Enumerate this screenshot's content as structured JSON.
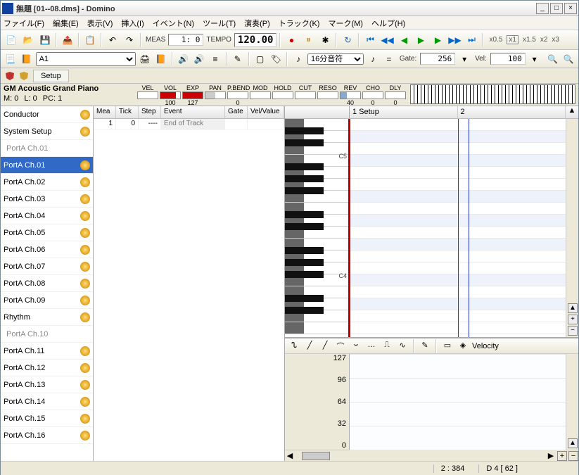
{
  "window": {
    "title": "無題 [01--08.dms] - Domino"
  },
  "menu": {
    "file": "ファイル(F)",
    "edit": "編集(E)",
    "view": "表示(V)",
    "insert": "挿入(I)",
    "event": "イベント(N)",
    "tool": "ツール(T)",
    "play": "演奏(P)",
    "track": "トラック(K)",
    "mark": "マーク(M)",
    "help": "ヘルプ(H)"
  },
  "transport": {
    "meas_label": "MEAS",
    "meas": "1:    0",
    "tempo_label": "TEMPO",
    "tempo": "120.00"
  },
  "zoom": {
    "z05": "x0.5",
    "z1": "x1",
    "z15": "x1.5",
    "z2": "x2",
    "z3": "x3"
  },
  "patch": {
    "selected": "A1",
    "noteval": "16分音符",
    "gate_label": "Gate:",
    "gate": "256",
    "vel_label": "Vel:",
    "vel": "100"
  },
  "setup": {
    "label": "Setup"
  },
  "instrument": {
    "name": "GM Acoustic Grand Piano",
    "m": "M:    0",
    "l": "L:    0",
    "pc": "PC:    1"
  },
  "cc": [
    {
      "name": "VEL",
      "val": ""
    },
    {
      "name": "VOL",
      "val": "100",
      "color": "#cc0000",
      "pct": 79
    },
    {
      "name": "EXP",
      "val": "127",
      "color": "#cc0000",
      "pct": 100
    },
    {
      "name": "PAN",
      "val": "",
      "color": "#cccccc",
      "pct": 50
    },
    {
      "name": "P.BEND",
      "val": "0"
    },
    {
      "name": "MOD",
      "val": ""
    },
    {
      "name": "HOLD",
      "val": ""
    },
    {
      "name": "CUT",
      "val": ""
    },
    {
      "name": "RESO",
      "val": ""
    },
    {
      "name": "REV",
      "val": "40",
      "color": "#88aacc",
      "pct": 31
    },
    {
      "name": "CHO",
      "val": "0"
    },
    {
      "name": "DLY",
      "val": "0"
    }
  ],
  "tracks": [
    {
      "label": "Conductor",
      "sub": false
    },
    {
      "label": "System Setup",
      "sub": false
    },
    {
      "label": "PortA  Ch.01",
      "sub": true
    },
    {
      "label": "PortA  Ch.01",
      "sub": false,
      "sel": true
    },
    {
      "label": "PortA  Ch.02",
      "sub": false
    },
    {
      "label": "PortA  Ch.03",
      "sub": false
    },
    {
      "label": "PortA  Ch.04",
      "sub": false
    },
    {
      "label": "PortA  Ch.05",
      "sub": false
    },
    {
      "label": "PortA  Ch.06",
      "sub": false
    },
    {
      "label": "PortA  Ch.07",
      "sub": false
    },
    {
      "label": "PortA  Ch.08",
      "sub": false
    },
    {
      "label": "PortA  Ch.09",
      "sub": false
    },
    {
      "label": "Rhythm",
      "sub": false
    },
    {
      "label": "PortA  Ch.10",
      "sub": true
    },
    {
      "label": "PortA  Ch.11",
      "sub": false
    },
    {
      "label": "PortA  Ch.12",
      "sub": false
    },
    {
      "label": "PortA  Ch.13",
      "sub": false
    },
    {
      "label": "PortA  Ch.14",
      "sub": false
    },
    {
      "label": "PortA  Ch.15",
      "sub": false
    },
    {
      "label": "PortA  Ch.16",
      "sub": false
    }
  ],
  "evcols": {
    "mea": "Mea",
    "tick": "Tick",
    "step": "Step",
    "event": "Event",
    "gate": "Gate",
    "velval": "Vel/Value"
  },
  "events": [
    {
      "mea": "1",
      "tick": "0",
      "step": "----",
      "event": "End of Track"
    }
  ],
  "ruler": {
    "m1": "1 Setup",
    "m2": "2"
  },
  "octaves": {
    "c5": "C5",
    "c4": "C4"
  },
  "velocity": {
    "label": "Velocity",
    "ticks": [
      "127",
      "96",
      "64",
      "32",
      "0"
    ]
  },
  "status": {
    "pos": "2 : 384",
    "note": "D  4 [ 62 ]"
  }
}
